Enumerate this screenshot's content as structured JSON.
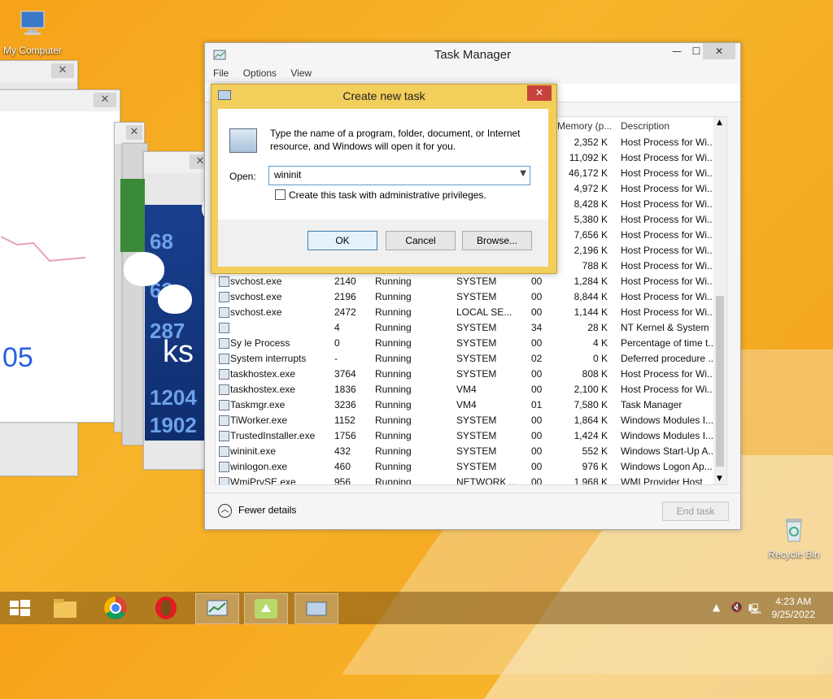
{
  "desktop": {
    "my_computer_label": "My Computer",
    "recycle_bin_label": "Recycle Bin"
  },
  "task_manager": {
    "title": "Task Manager",
    "menu": [
      "File",
      "Options",
      "View"
    ],
    "headers": {
      "memory": "Memory (p...",
      "description": "Description"
    },
    "hidden_rows_memory": [
      "2,352 K",
      "11,092 K",
      "46,172 K",
      "4,972 K",
      "8,428 K",
      "5,380 K",
      "7,656 K",
      "2,196 K",
      "788 K"
    ],
    "hidden_rows_desc": [
      "Host Process for Wi...",
      "Host Process for Wi...",
      "Host Process for Wi...",
      "Host Process for Wi...",
      "Host Process for Wi...",
      "Host Process for Wi...",
      "Host Process for Wi...",
      "Host Process for Wi...",
      "Host Process for Wi..."
    ],
    "rows": [
      {
        "name": "svchost.exe",
        "pid": "2140",
        "status": "Running",
        "user": "SYSTEM",
        "cpu": "00",
        "mem": "1,284 K",
        "desc": "Host Process for Wi..."
      },
      {
        "name": "svchost.exe",
        "pid": "2196",
        "status": "Running",
        "user": "SYSTEM",
        "cpu": "00",
        "mem": "8,844 K",
        "desc": "Host Process for Wi..."
      },
      {
        "name": "svchost.exe",
        "pid": "2472",
        "status": "Running",
        "user": "LOCAL SE...",
        "cpu": "00",
        "mem": "1,144 K",
        "desc": "Host Process for Wi..."
      },
      {
        "name": "",
        "pid": "4",
        "status": "Running",
        "user": "SYSTEM",
        "cpu": "34",
        "mem": "28 K",
        "desc": "NT Kernel & System"
      },
      {
        "name": "Sy      le Process",
        "pid": "0",
        "status": "Running",
        "user": "SYSTEM",
        "cpu": "00",
        "mem": "4 K",
        "desc": "Percentage of time t..."
      },
      {
        "name": "System interrupts",
        "pid": "-",
        "status": "Running",
        "user": "SYSTEM",
        "cpu": "02",
        "mem": "0 K",
        "desc": "Deferred procedure ..."
      },
      {
        "name": "taskhostex.exe",
        "pid": "3764",
        "status": "Running",
        "user": "SYSTEM",
        "cpu": "00",
        "mem": "808 K",
        "desc": "Host Process for Wi..."
      },
      {
        "name": "taskhostex.exe",
        "pid": "1836",
        "status": "Running",
        "user": "VM4",
        "cpu": "00",
        "mem": "2,100 K",
        "desc": "Host Process for Wi..."
      },
      {
        "name": "Taskmgr.exe",
        "pid": "3236",
        "status": "Running",
        "user": "VM4",
        "cpu": "01",
        "mem": "7,580 K",
        "desc": "Task Manager"
      },
      {
        "name": "TiWorker.exe",
        "pid": "1152",
        "status": "Running",
        "user": "SYSTEM",
        "cpu": "00",
        "mem": "1,864 K",
        "desc": "Windows Modules I..."
      },
      {
        "name": "TrustedInstaller.exe",
        "pid": "1756",
        "status": "Running",
        "user": "SYSTEM",
        "cpu": "00",
        "mem": "1,424 K",
        "desc": "Windows Modules I..."
      },
      {
        "name": "wininit.exe",
        "pid": "432",
        "status": "Running",
        "user": "SYSTEM",
        "cpu": "00",
        "mem": "552 K",
        "desc": "Windows Start-Up A..."
      },
      {
        "name": "winlogon.exe",
        "pid": "460",
        "status": "Running",
        "user": "SYSTEM",
        "cpu": "00",
        "mem": "976 K",
        "desc": "Windows Logon Ap..."
      },
      {
        "name": "WmiPrvSE.exe",
        "pid": "956",
        "status": "Running",
        "user": "NETWORK ...",
        "cpu": "00",
        "mem": "1,968 K",
        "desc": "WMI Provider Host"
      }
    ],
    "fewer_details": "Fewer details",
    "end_task": "End task"
  },
  "dialog": {
    "title": "Create new task",
    "description": "Type the name of a program, folder, document, or Internet resource, and Windows will open it for you.",
    "open_label": "Open:",
    "open_value": "wininit",
    "admin_checkbox": "Create this task with administrative privileges.",
    "ok": "OK",
    "cancel": "Cancel",
    "browse": "Browse..."
  },
  "background_windows": {
    "graph_text": "05",
    "blue_numbers": [
      "68",
      "63",
      "287",
      "1204",
      "1902"
    ],
    "big_text": "ks"
  },
  "taskbar": {
    "time": "4:23 AM",
    "date": "9/25/2022"
  },
  "colors": {
    "desktop_orange": "#f6a21a",
    "dialog_frame": "#f2ce5b",
    "close_red": "#c7423b"
  }
}
